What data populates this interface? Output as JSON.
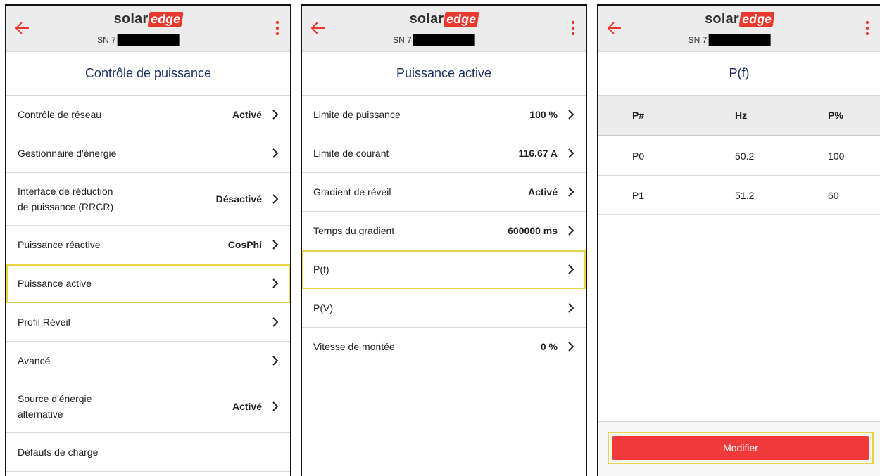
{
  "brand": {
    "solar": "solar",
    "edge": "edge",
    "sn_prefix": "SN 7",
    "accent": "#f0393a",
    "title_color": "#1c2f63"
  },
  "screen1": {
    "title": "Contrôle de puissance",
    "items": [
      {
        "label": "Contrôle de réseau",
        "value": "Activé"
      },
      {
        "label": "Gestionnaire d'énergie",
        "value": ""
      },
      {
        "label_line1": "Interface de réduction",
        "label_line2": "de puissance (RRCR)",
        "value": "Désactivé"
      },
      {
        "label": "Puissance réactive",
        "value": "CosPhi"
      },
      {
        "label": "Puissance active",
        "value": ""
      },
      {
        "label": "Profil Réveil",
        "value": ""
      },
      {
        "label": "Avancé",
        "value": ""
      },
      {
        "label_line1": "Source d'énergie",
        "label_line2": "alternative",
        "value": "Activé"
      },
      {
        "label": "Défauts de charge",
        "value": ""
      }
    ]
  },
  "screen2": {
    "title": "Puissance active",
    "items": [
      {
        "label": "Limite de puissance",
        "value": "100 %"
      },
      {
        "label": "Limite de courant",
        "value": "116.67 A"
      },
      {
        "label": "Gradient de réveil",
        "value": "Activé"
      },
      {
        "label": "Temps du gradient",
        "value": "600000 ms"
      },
      {
        "label": "P(f)",
        "value": ""
      },
      {
        "label": "P(V)",
        "value": ""
      },
      {
        "label": "Vitesse de montée",
        "value": "0 %"
      }
    ]
  },
  "screen3": {
    "title": "P(f)",
    "columns": [
      "P#",
      "Hz",
      "P%"
    ],
    "rows": [
      [
        "P0",
        "50.2",
        "100"
      ],
      [
        "P1",
        "51.2",
        "60"
      ]
    ],
    "button_label": "Modifier"
  },
  "icons": {
    "back": "arrow-left-icon",
    "menu": "more-vert-icon",
    "chevron": "chevron-right-icon"
  }
}
